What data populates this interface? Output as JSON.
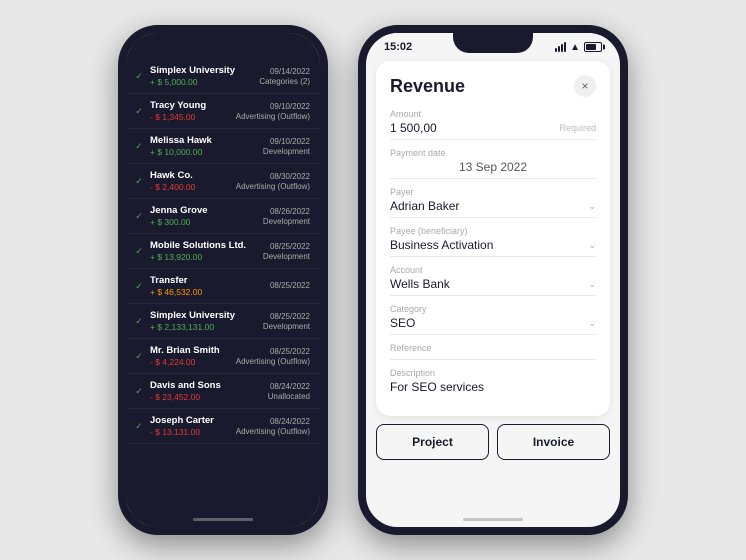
{
  "left_phone": {
    "transactions": [
      {
        "name": "Simplex University",
        "amount": "+ $ 5,000.00",
        "amount_type": "positive",
        "date": "09/14/2022",
        "category": "Categories (2)",
        "checked": true
      },
      {
        "name": "Tracy Young",
        "amount": "- $ 1,345.00",
        "amount_type": "negative",
        "date": "09/10/2022",
        "category": "Advertising (Outflow)",
        "checked": true
      },
      {
        "name": "Melissa Hawk",
        "amount": "+ $ 10,000.00",
        "amount_type": "positive",
        "date": "09/10/2022",
        "category": "Development",
        "checked": true
      },
      {
        "name": "Hawk Co.",
        "amount": "- $ 2,400.00",
        "amount_type": "negative",
        "date": "08/30/2022",
        "category": "Advertising (Outflow)",
        "checked": true
      },
      {
        "name": "Jenna Grove",
        "amount": "+ $ 300.00",
        "amount_type": "positive",
        "date": "08/26/2022",
        "category": "Development",
        "checked": true
      },
      {
        "name": "Mobile Solutions Ltd.",
        "amount": "+ $ 13,920.00",
        "amount_type": "positive",
        "date": "08/25/2022",
        "category": "Development",
        "checked": true
      },
      {
        "name": "Transfer",
        "amount": "+ $ 46,532.00",
        "amount_type": "orange",
        "date": "08/25/2022",
        "category": "",
        "checked": true
      },
      {
        "name": "Simplex University",
        "amount": "+ $ 2,133,131.00",
        "amount_type": "positive",
        "date": "08/25/2022",
        "category": "Development",
        "checked": true
      },
      {
        "name": "Mr. Brian Smith",
        "amount": "- $ 4,224.00",
        "amount_type": "negative",
        "date": "08/25/2022",
        "category": "Advertising (Outflow)",
        "checked": true
      },
      {
        "name": "Davis and Sons",
        "amount": "- $ 23,452.00",
        "amount_type": "negative",
        "date": "08/24/2022",
        "category": "Unallocated",
        "checked": true
      },
      {
        "name": "Joseph Carter",
        "amount": "- $ 13,131.00",
        "amount_type": "negative",
        "date": "08/24/2022",
        "category": "Advertising (Outflow)",
        "checked": true
      }
    ]
  },
  "right_phone": {
    "status_bar": {
      "time": "15:02"
    },
    "form": {
      "title": "Revenue",
      "close_label": "×",
      "amount_label": "Amount",
      "amount_value": "1 500,00",
      "amount_hint": "Required",
      "payment_date_label": "Payment date",
      "payment_date_value": "13 Sep 2022",
      "payer_label": "Payer",
      "payer_value": "Adrian Baker",
      "payee_label": "Payee (beneficiary)",
      "payee_value": "Business Activation",
      "account_label": "Account",
      "account_value": "Wells Bank",
      "category_label": "Category",
      "category_value": "SEO",
      "reference_label": "Reference",
      "reference_placeholder": "",
      "description_label": "Description",
      "description_value": "For SEO services",
      "btn_project": "Project",
      "btn_invoice": "Invoice"
    }
  }
}
